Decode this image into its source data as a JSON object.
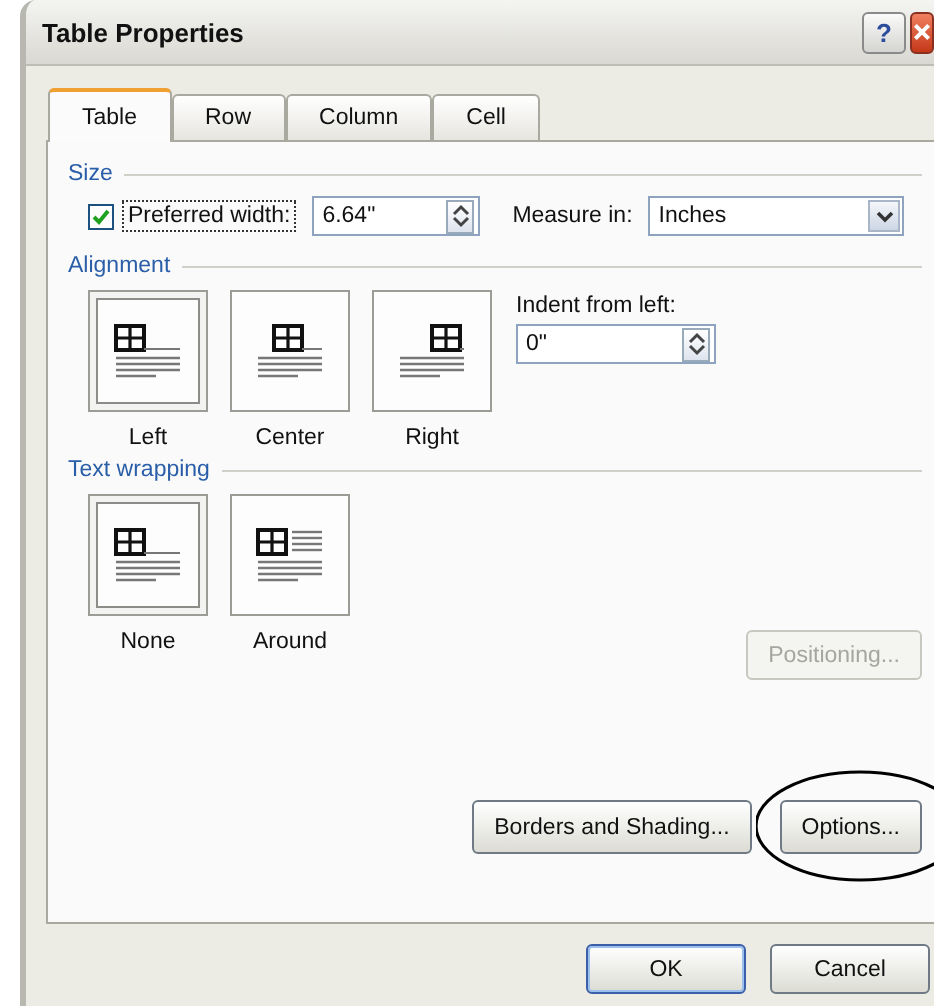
{
  "window": {
    "title": "Table Properties",
    "help_button": "?"
  },
  "tabs": [
    {
      "label": "Table",
      "selected": true
    },
    {
      "label": "Row",
      "selected": false
    },
    {
      "label": "Column",
      "selected": false
    },
    {
      "label": "Cell",
      "selected": false
    }
  ],
  "size": {
    "heading": "Size",
    "preferred_width": {
      "label": "Preferred width:",
      "checked": true,
      "value": "6.64\""
    },
    "measure_in": {
      "label": "Measure in:",
      "value": "Inches"
    }
  },
  "alignment": {
    "heading": "Alignment",
    "options": [
      {
        "kind": "left",
        "label": "Left",
        "selected": true
      },
      {
        "kind": "center",
        "label": "Center",
        "selected": false
      },
      {
        "kind": "right",
        "label": "Right",
        "selected": false
      }
    ],
    "indent": {
      "label": "Indent from left:",
      "value": "0\""
    }
  },
  "text_wrapping": {
    "heading": "Text wrapping",
    "options": [
      {
        "kind": "none",
        "label": "None",
        "selected": true
      },
      {
        "kind": "around",
        "label": "Around",
        "selected": false
      }
    ],
    "positioning": {
      "label": "Positioning...",
      "disabled": true
    }
  },
  "panel_buttons": [
    {
      "label": "Borders and Shading...",
      "circled": false
    },
    {
      "label": "Options...",
      "circled": true
    }
  ],
  "dialog_buttons": [
    {
      "label": "OK",
      "default": true
    },
    {
      "label": "Cancel",
      "default": false
    }
  ]
}
